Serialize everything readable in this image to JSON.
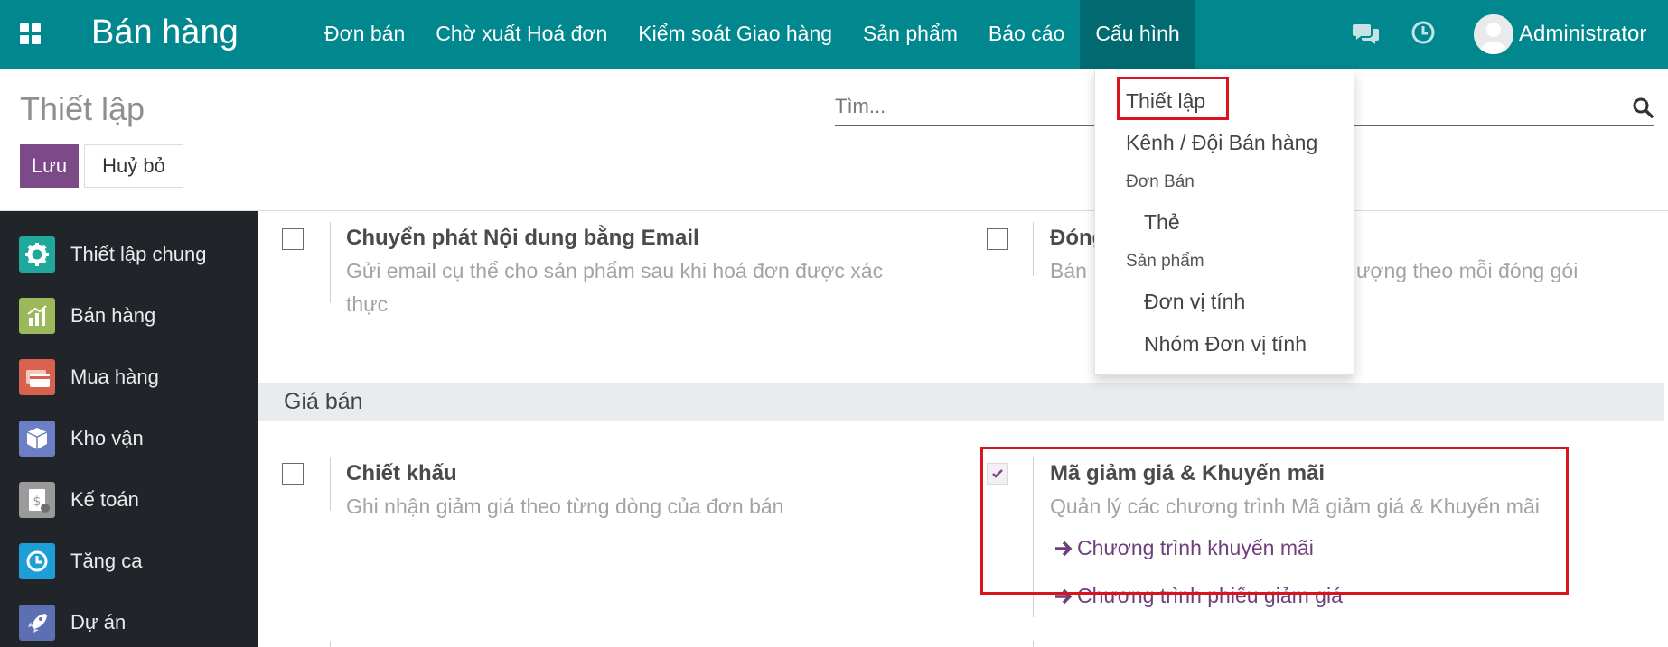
{
  "navbar": {
    "brand": "Bán hàng",
    "menu": [
      "Đơn bán",
      "Chờ xuất Hoá đơn",
      "Kiểm soát Giao hàng",
      "Sản phẩm",
      "Báo cáo",
      "Cấu hình"
    ],
    "active_menu": "Cấu hình",
    "user": "Administrator",
    "color": "#01878e"
  },
  "control_panel": {
    "title": "Thiết lập",
    "search_placeholder": "Tìm...",
    "save_label": "Lưu",
    "cancel_label": "Huỷ bỏ"
  },
  "sidebar": {
    "items": [
      {
        "label": "Thiết lập chung",
        "icon": "gear-icon",
        "color": "#1fa89b"
      },
      {
        "label": "Bán hàng",
        "icon": "sales-chart-icon",
        "color": "#9bb85a"
      },
      {
        "label": "Mua hàng",
        "icon": "credit-card-icon",
        "color": "#d9624f"
      },
      {
        "label": "Kho vận",
        "icon": "box-icon",
        "color": "#6b7fc4"
      },
      {
        "label": "Kế toán",
        "icon": "invoice-icon",
        "color": "#9a9a9a"
      },
      {
        "label": "Tăng ca",
        "icon": "clock-icon",
        "color": "#1e9ed6"
      },
      {
        "label": "Dự án",
        "icon": "rocket-icon",
        "color": "#5c6fb2"
      }
    ]
  },
  "settings": {
    "email_delivery": {
      "title": "Chuyển phát Nội dung bằng Email",
      "desc_line1": "Gửi email cụ thể cho sản phẩm sau khi hoá đơn được xác",
      "desc_line2": "thực",
      "checked": false
    },
    "packaging": {
      "title_partial": "Đóng",
      "desc_partial_left": "Bán",
      "desc_partial_right": "ượng theo mỗi đóng gói",
      "checked": false
    },
    "section_title": "Giá bán",
    "discount": {
      "title": "Chiết khấu",
      "desc": "Ghi nhận giảm giá theo từng dòng của đơn bán",
      "checked": false
    },
    "coupons": {
      "title": "Mã giảm giá & Khuyến mãi",
      "desc": "Quản lý các chương trình Mã giảm giá & Khuyến mãi",
      "checked": true,
      "links": [
        "Chương trình khuyến mãi",
        "Chương trình phiếu giảm giá"
      ]
    }
  },
  "dropdown": {
    "items": [
      {
        "label": "Thiết lập",
        "type": "item"
      },
      {
        "label": "Kênh / Đội Bán hàng",
        "type": "item"
      },
      {
        "label": "Đơn Bán",
        "type": "header"
      },
      {
        "label": "Thẻ",
        "type": "subitem"
      },
      {
        "label": "Sản phẩm",
        "type": "header"
      },
      {
        "label": "Đơn vị tính",
        "type": "subitem"
      },
      {
        "label": "Nhóm Đơn vị tính",
        "type": "subitem"
      }
    ]
  },
  "colors": {
    "accent_purple": "#7c4a87",
    "link_purple": "#6f3f7b",
    "highlight_red": "#d9141c"
  }
}
